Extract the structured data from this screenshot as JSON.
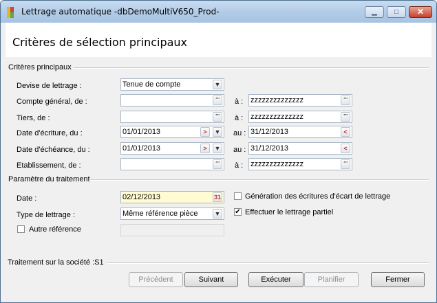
{
  "window": {
    "title": "Lettrage automatique -dbDemoMultiV650_Prod-",
    "minimize_glyph": "▁",
    "maximize_glyph": "□",
    "close_glyph": "✕",
    "icon": "app-colored-blocks-icon"
  },
  "page": {
    "title": "Critères de sélection principaux"
  },
  "criteria": {
    "section_label": "Critères principaux",
    "devise": {
      "label": "Devise de lettrage :",
      "value": "Tenue de compte"
    },
    "compte": {
      "label": "Compte général, de :",
      "from": "",
      "to_label": "à :",
      "to": "zzzzzzzzzzzzzz"
    },
    "tiers": {
      "label": "Tiers, de :",
      "from": "",
      "to_label": "à :",
      "to": "zzzzzzzzzzzzzz"
    },
    "date_ecriture": {
      "label": "Date d'écriture, du :",
      "from": "01/01/2013",
      "to_label": "au :",
      "to": "31/12/2013"
    },
    "date_echeance": {
      "label": "Date d'échéance, du :",
      "from": "01/01/2013",
      "to_label": "au :",
      "to": "31/12/2013"
    },
    "etablissement": {
      "label": "Etablissement, de :",
      "from": "",
      "to_label": "à :",
      "to": "zzzzzzzzzzzzzz"
    }
  },
  "traitement": {
    "section_label": "Paramètre du traitement",
    "date": {
      "label": "Date :",
      "value": "02/12/2013",
      "calendar_text": "31"
    },
    "type": {
      "label": "Type de lettrage :",
      "value": "Même référence pièce"
    },
    "autre_reference": {
      "label": "Autre référence",
      "checked": false
    },
    "generation_ecart": {
      "label": "Génération des écritures d'écart de lettrage",
      "checked": false
    },
    "lettrage_partiel": {
      "label": "Effectuer le lettrage partiel",
      "checked": true,
      "check_glyph": "✔"
    }
  },
  "footer": {
    "societe_label": "Traitement sur la société :S1",
    "buttons": {
      "precedent": "Précédent",
      "suivant": "Suivant",
      "executer": "Exécuter",
      "planifier": "Planifier",
      "fermer": "Fermer"
    }
  },
  "glyphs": {
    "dots": "···",
    "chevron_down": "▼",
    "chevron_right": ">",
    "chevron_left": "<"
  },
  "colors": {
    "date_highlight": "#fffbd2",
    "title_bar": "#b3cde8"
  }
}
